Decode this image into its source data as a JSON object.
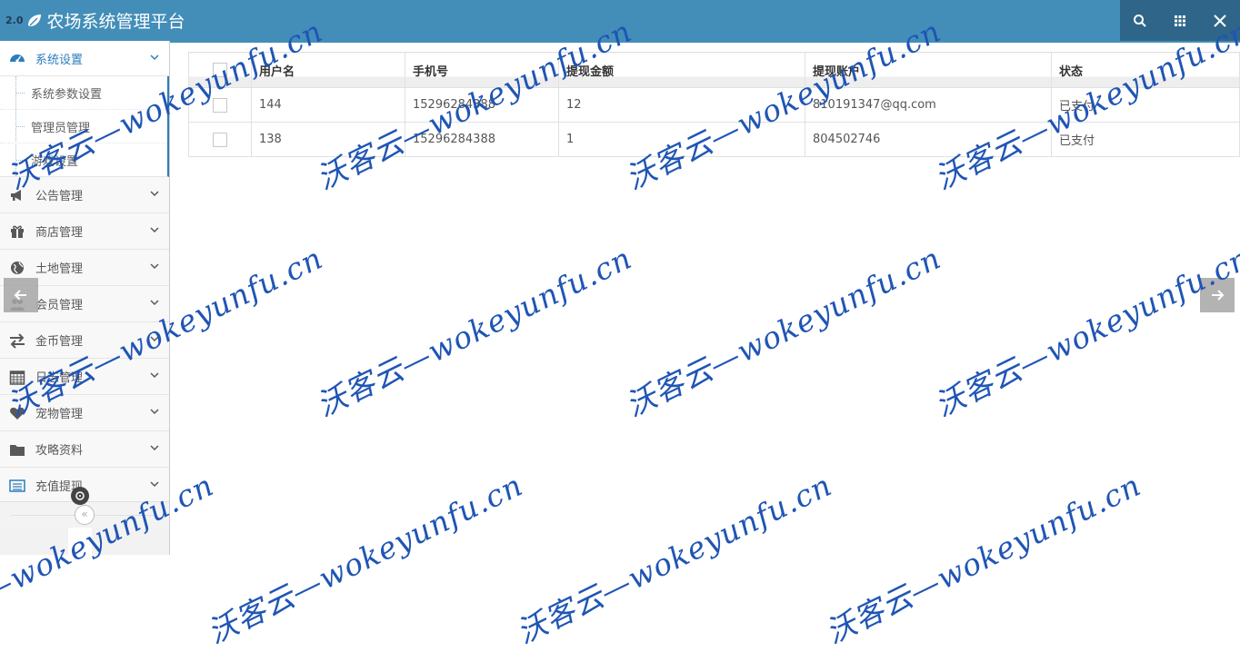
{
  "header": {
    "version_badge": "2.0",
    "title": "农场系统管理平台",
    "actions": [
      {
        "name": "search-icon"
      },
      {
        "name": "grid-icon"
      },
      {
        "name": "close-icon"
      }
    ]
  },
  "sidebar": {
    "items": [
      {
        "label": "系统设置",
        "icon": "dashboard-icon",
        "active": true,
        "children": [
          "系统参数设置",
          "管理员管理",
          "游戏设置"
        ]
      },
      {
        "label": "公告管理",
        "icon": "megaphone-icon"
      },
      {
        "label": "商店管理",
        "icon": "gift-icon"
      },
      {
        "label": "土地管理",
        "icon": "globe-icon"
      },
      {
        "label": "会员管理",
        "icon": "users-icon"
      },
      {
        "label": "金币管理",
        "icon": "exchange-icon"
      },
      {
        "label": "日志管理",
        "icon": "calendar-icon"
      },
      {
        "label": "宠物管理",
        "icon": "heart-icon"
      },
      {
        "label": "攻略资料",
        "icon": "folder-icon"
      },
      {
        "label": "充值提现",
        "icon": "list-icon"
      }
    ],
    "collapse_glyph": "«"
  },
  "table": {
    "columns": [
      "用户名",
      "手机号",
      "提现金额",
      "提现账户",
      "状态"
    ],
    "rows": [
      [
        "144",
        "15296284388",
        "12",
        "810191347@qq.com",
        "已支付"
      ],
      [
        "138",
        "15296284388",
        "1",
        "804502746",
        "已支付"
      ]
    ]
  },
  "watermark": {
    "text": "沃客云—wokeyunfu.cn"
  },
  "colors": {
    "header_bg": "#438eb9",
    "header_actions_bg": "#2e6589",
    "accent": "#2b7dbc",
    "watermark": "#1f55b5"
  }
}
